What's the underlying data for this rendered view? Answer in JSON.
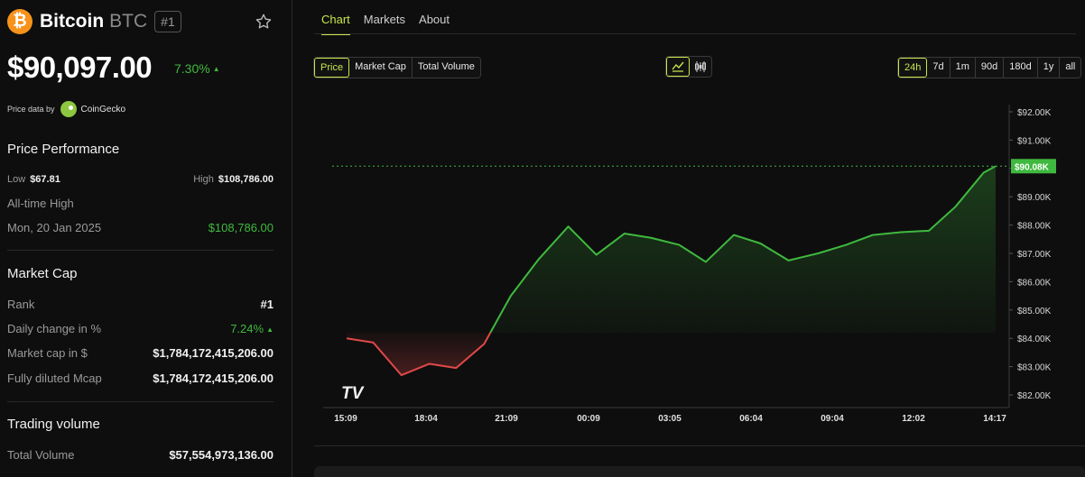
{
  "coin": {
    "logo_symbol": "₿",
    "name": "Bitcoin",
    "symbol": "BTC",
    "rank_badge": "#1",
    "price": "$90,097.00",
    "change": "7.30%",
    "change_arrow": "▲"
  },
  "price_data": {
    "label": "Price data by",
    "provider": "CoinGecko"
  },
  "performance": {
    "title": "Price Performance",
    "low_label": "Low",
    "low_value": "$67.81",
    "high_label": "High",
    "high_value": "$108,786.00",
    "ath_label": "All-time High",
    "ath_date": "Mon, 20 Jan 2025",
    "ath_value": "$108,786.00"
  },
  "market_cap": {
    "title": "Market Cap",
    "rank_label": "Rank",
    "rank_value": "#1",
    "daily_label": "Daily change in %",
    "daily_value": "7.24%",
    "daily_arrow": "▲",
    "mcap_label": "Market cap in $",
    "mcap_value": "$1,784,172,415,206.00",
    "fdv_label": "Fully diluted Mcap",
    "fdv_value": "$1,784,172,415,206.00"
  },
  "trading": {
    "title": "Trading volume",
    "total_label": "Total Volume",
    "total_value": "$57,554,973,136.00"
  },
  "tabs": [
    "Chart",
    "Markets",
    "About"
  ],
  "active_tab": "Chart",
  "chart_types": [
    "Price",
    "Market Cap",
    "Total Volume"
  ],
  "active_chart_type": "Price",
  "view_icons": [
    "line-chart-icon",
    "candlestick-icon"
  ],
  "ranges": [
    "24h",
    "7d",
    "1m",
    "90d",
    "180d",
    "1y",
    "all"
  ],
  "active_range": "24h",
  "colors": {
    "accent": "#c7e64a",
    "up": "#3fb93f",
    "down": "#e04848",
    "btc": "#f7931a"
  },
  "chart_data": {
    "type": "area",
    "x_tick_labels": [
      "15:09",
      "18:04",
      "21:09",
      "00:09",
      "03:05",
      "06:04",
      "09:04",
      "12:02",
      "14:17"
    ],
    "y_tick_labels": [
      "$92.00K",
      "$91.00K",
      "$90.00K",
      "$89.00K",
      "$88.00K",
      "$87.00K",
      "$86.00K",
      "$85.00K",
      "$84.00K",
      "$83.00K",
      "$82.00K"
    ],
    "ylim": [
      82000,
      92000
    ],
    "baseline": 84200,
    "last_price_label": "$90.08K",
    "last_price": 90080,
    "x_hours": [
      0,
      0.95,
      1.95,
      2.95,
      3.9,
      4.9,
      5.85,
      6.85,
      7.9,
      8.9,
      9.9,
      10.85,
      11.85,
      12.8,
      13.8,
      14.75,
      15.75,
      16.8,
      17.8,
      18.75,
      19.75,
      20.75,
      21.7,
      22.7,
      23.13
    ],
    "y": [
      84000,
      83850,
      82700,
      83100,
      82950,
      83800,
      85500,
      86800,
      87950,
      86950,
      87700,
      87550,
      87300,
      86700,
      87650,
      87350,
      86750,
      87000,
      87300,
      87650,
      87750,
      87800,
      88650,
      89850,
      90080
    ],
    "x_range_hours": [
      0,
      23.13
    ],
    "watermark": "TV"
  }
}
